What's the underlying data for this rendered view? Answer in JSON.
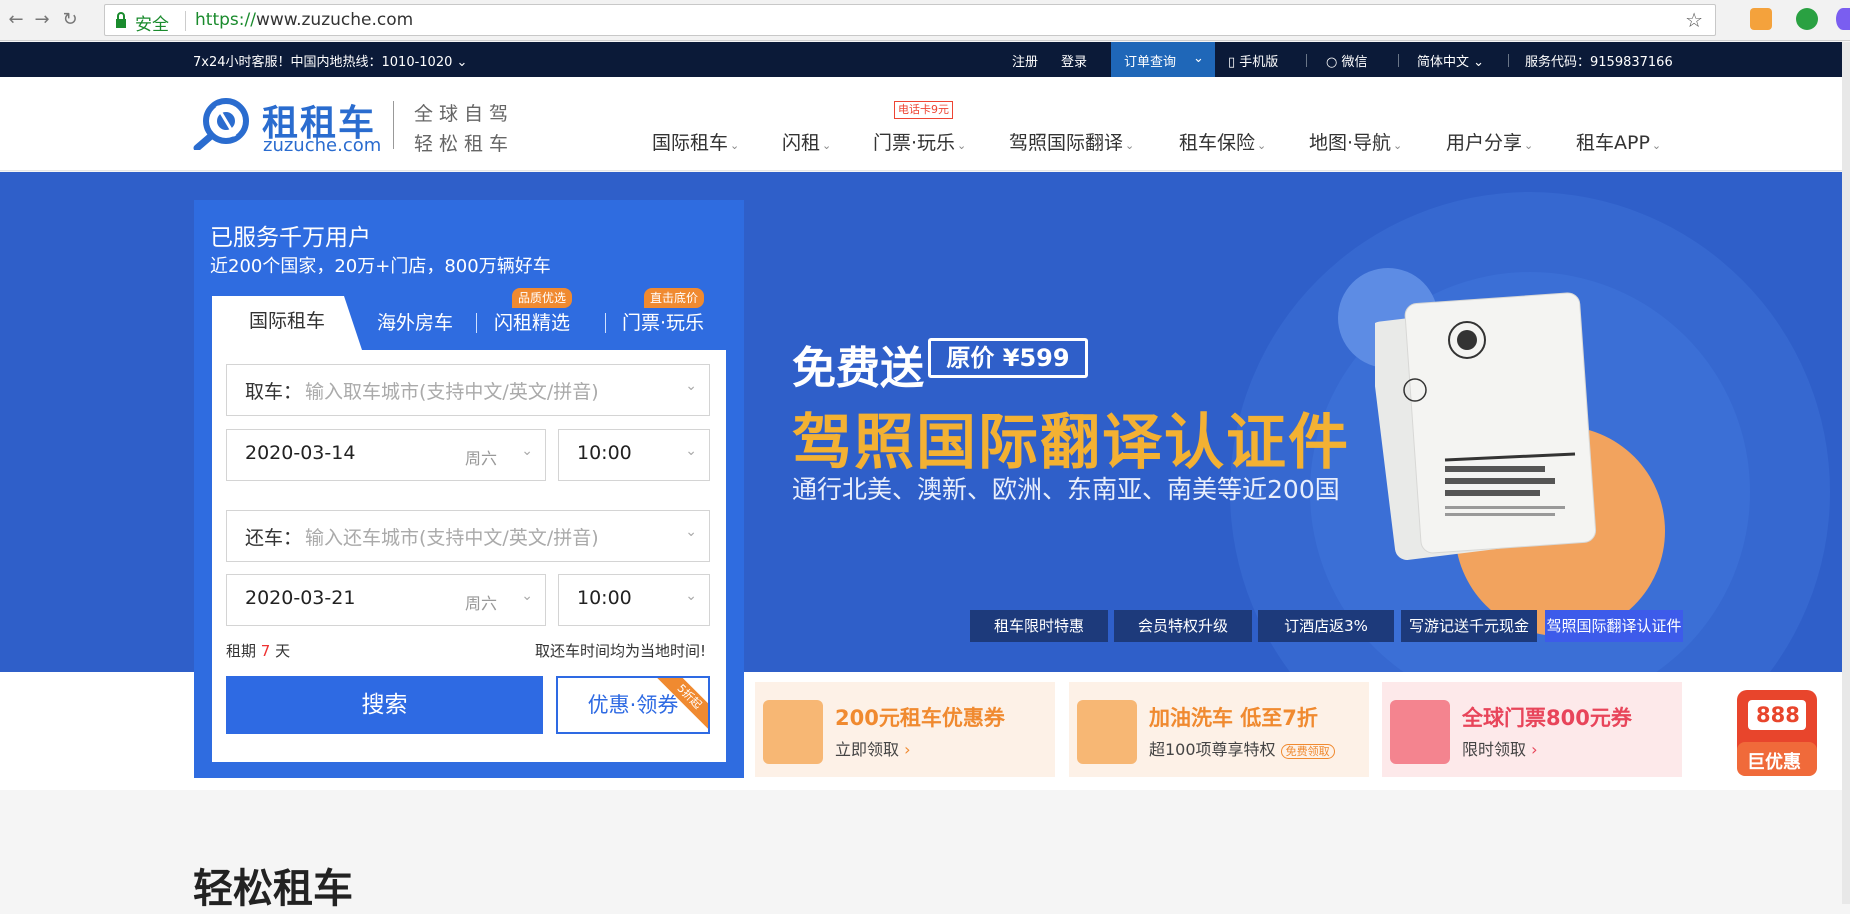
{
  "browser": {
    "secure_label": "安全",
    "url_protocol": "https://",
    "url_host": "www.zuzuche.com"
  },
  "topbar": {
    "hotline": "7x24小时客服！中国内地热线：1010-1020",
    "register": "注册",
    "login": "登录",
    "order_query": "订单查询",
    "mobile": "手机版",
    "wechat": "微信",
    "language": "简体中文",
    "service_code": "服务代码：9159837166"
  },
  "header": {
    "logo_cn": "租租车",
    "logo_en": "zuzuche.com",
    "slogan_line1": "全球自驾",
    "slogan_line2": "轻松租车",
    "nav_tag": "电话卡9元",
    "nav": [
      "国际租车",
      "闪租",
      "门票·玩乐",
      "驾照国际翻译",
      "租车保险",
      "地图·导航",
      "用户分享",
      "租车APP"
    ]
  },
  "banner": {
    "free_text": "免费送",
    "original_price": "原价 ¥599",
    "title": "驾照国际翻译认证件",
    "subtitle": "通行北美、澳新、欧洲、东南亚、南美等近200国",
    "tabs": [
      "租车限时特惠",
      "会员特权升级",
      "订酒店返3%",
      "写游记送千元现金",
      "驾照国际翻译认证件"
    ]
  },
  "search": {
    "title": "已服务千万用户",
    "subtitle": "近200个国家，20万+门店，800万辆好车",
    "tabs": [
      "国际租车",
      "海外房车",
      "闪租精选",
      "门票·玩乐"
    ],
    "tab_tags": [
      "品质优选",
      "直击底价"
    ],
    "pickup_label": "取车：",
    "pickup_placeholder": "输入取车城市(支持中文/英文/拼音)",
    "pickup_date": "2020-03-14",
    "pickup_weekday": "周六",
    "pickup_time": "10:00",
    "return_label": "还车：",
    "return_placeholder": "输入还车城市(支持中文/英文/拼音)",
    "return_date": "2020-03-21",
    "return_weekday": "周六",
    "return_time": "10:00",
    "rent_prefix": "租期",
    "rent_days": "7",
    "rent_suffix": "天",
    "local_time_note": "取还车时间均为当地时间!",
    "search_button": "搜索",
    "coupon_button": "优惠·领券",
    "coupon_ribbon": "5折起"
  },
  "promos": [
    {
      "title": "200元租车优惠券",
      "sub": "立即领取",
      "color": "#f08a30",
      "bg": "#fdf1e7"
    },
    {
      "title": "加油洗车 低至7折",
      "sub": "超100项尊享特权",
      "badge": "免费领取",
      "color": "#f08a30",
      "bg": "#fdf1e7"
    },
    {
      "title": "全球门票800元券",
      "sub": "限时领取",
      "color": "#e8455a",
      "bg": "#fde9ea"
    }
  ],
  "gift": {
    "amount": "888",
    "label": "巨优惠"
  },
  "section": {
    "title": "轻松租车"
  }
}
